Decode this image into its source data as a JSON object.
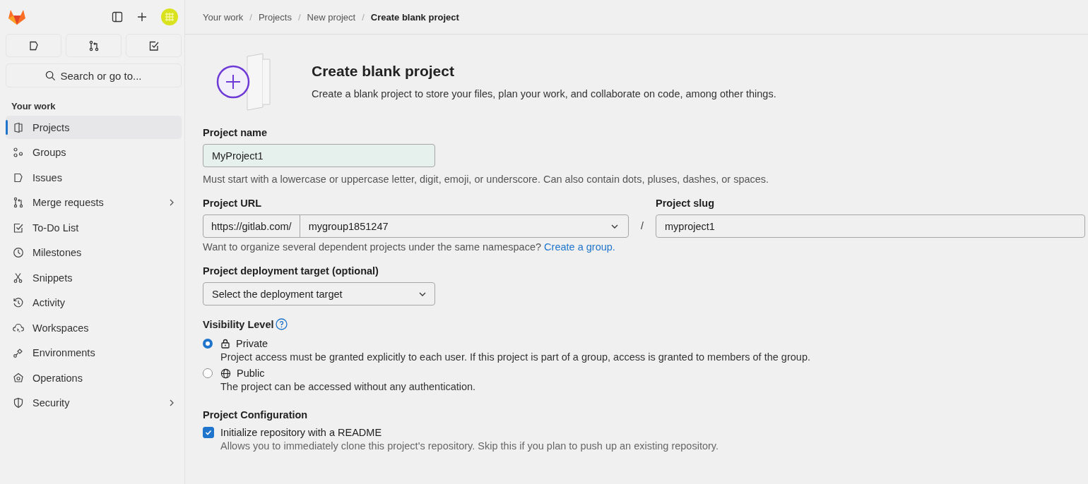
{
  "sidebar": {
    "search": {
      "placeholder": "Search or go to..."
    },
    "section_title": "Your work",
    "items": [
      {
        "label": "Projects",
        "selected": true,
        "has_submenu": false
      },
      {
        "label": "Groups",
        "selected": false,
        "has_submenu": false
      },
      {
        "label": "Issues",
        "selected": false,
        "has_submenu": false
      },
      {
        "label": "Merge requests",
        "selected": false,
        "has_submenu": true
      },
      {
        "label": "To-Do List",
        "selected": false,
        "has_submenu": false
      },
      {
        "label": "Milestones",
        "selected": false,
        "has_submenu": false
      },
      {
        "label": "Snippets",
        "selected": false,
        "has_submenu": false
      },
      {
        "label": "Activity",
        "selected": false,
        "has_submenu": false
      },
      {
        "label": "Workspaces",
        "selected": false,
        "has_submenu": false
      },
      {
        "label": "Environments",
        "selected": false,
        "has_submenu": false
      },
      {
        "label": "Operations",
        "selected": false,
        "has_submenu": false
      },
      {
        "label": "Security",
        "selected": false,
        "has_submenu": true
      }
    ]
  },
  "breadcrumbs": [
    {
      "label": "Your work",
      "current": false
    },
    {
      "separator": "/",
      "label": "Projects",
      "current": false
    },
    {
      "separator": "/",
      "label": "New project",
      "current": false
    },
    {
      "separator": "/",
      "label": "Create blank project",
      "current": true
    }
  ],
  "header": {
    "title": "Create blank project",
    "description": "Create a blank project to store your files, plan your work, and collaborate on code, among other things."
  },
  "project_name": {
    "label": "Project name",
    "value": "MyProject1",
    "help": "Must start with a lowercase or uppercase letter, digit, emoji, or underscore. Can also contain dots, pluses, dashes, or spaces."
  },
  "project_url": {
    "label": "Project URL",
    "prefix": "https://gitlab.com/",
    "namespace": "mygroup1851247",
    "separator": "/",
    "help": "Want to organize several dependent projects under the same namespace?",
    "help_link": "Create a group."
  },
  "project_slug": {
    "label": "Project slug",
    "value": "myproject1"
  },
  "deployment_target": {
    "label": "Project deployment target (optional)",
    "placeholder": "Select the deployment target"
  },
  "visibility": {
    "label": "Visibility Level",
    "options": [
      {
        "label": "Private",
        "description": "Project access must be granted explicitly to each user. If this project is part of a group, access is granted to members of the group.",
        "selected": true
      },
      {
        "label": "Public",
        "description": "The project can be accessed without any authentication.",
        "selected": false
      }
    ]
  },
  "configuration": {
    "label": "Project Configuration",
    "options": [
      {
        "label": "Initialize repository with a README",
        "description": "Allows you to immediately clone this project's repository. Skip this if you plan to push up an existing repository.",
        "checked": true
      }
    ]
  }
}
